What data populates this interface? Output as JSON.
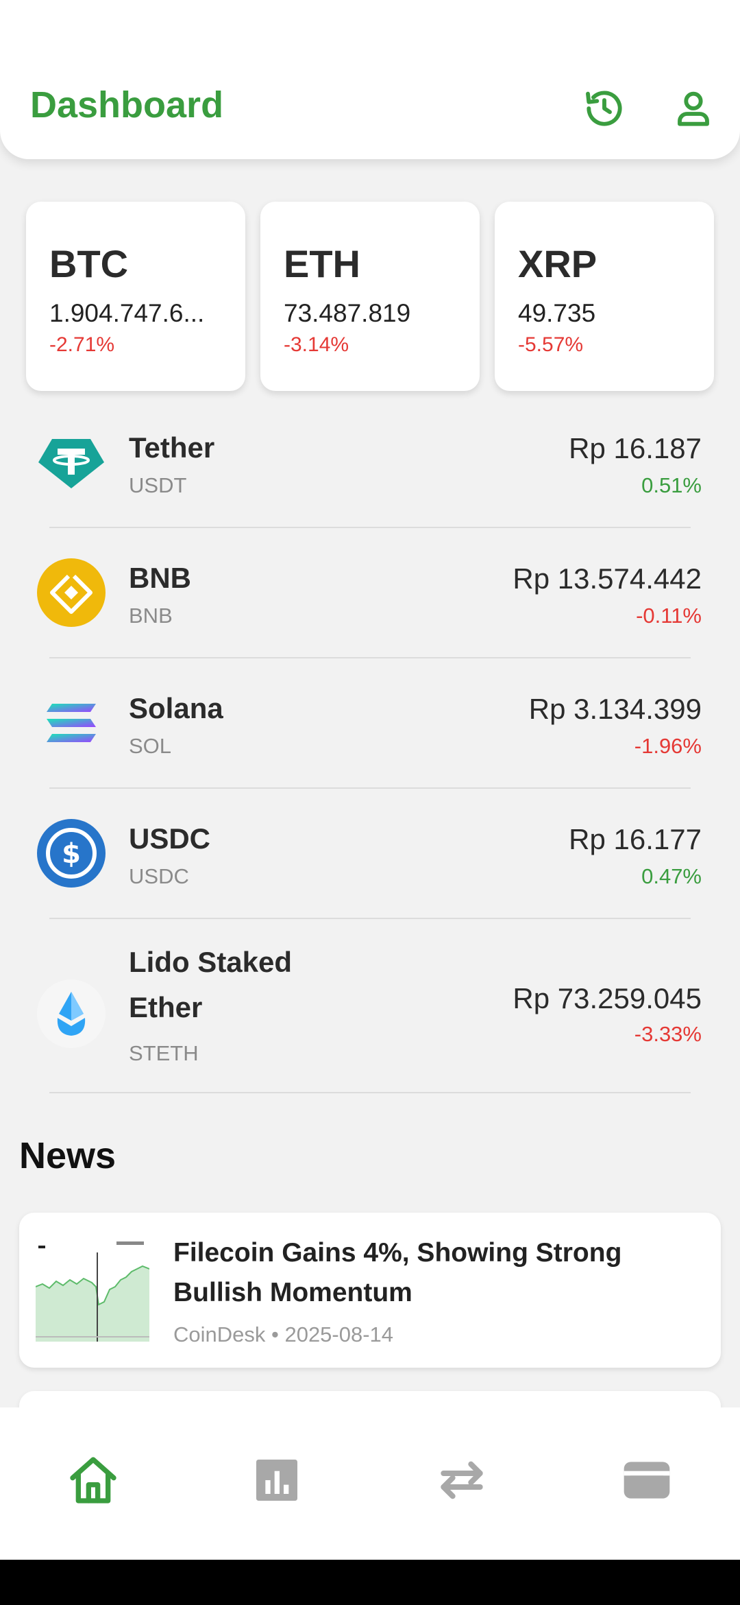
{
  "header": {
    "title": "Dashboard",
    "icons": [
      "history-icon",
      "profile-icon"
    ],
    "accent": "#3a9d3f"
  },
  "tickers": [
    {
      "symbol": "BTC",
      "price": "1.904.747.6...",
      "change": "-2.71%"
    },
    {
      "symbol": "ETH",
      "price": "73.487.819",
      "change": "-3.14%"
    },
    {
      "symbol": "XRP",
      "price": "49.735",
      "change": "-5.57%"
    }
  ],
  "coins": [
    {
      "name": "Tether",
      "ticker": "USDT",
      "price": "Rp 16.187",
      "change": "0.51%",
      "icon": "tether-logo"
    },
    {
      "name": "BNB",
      "ticker": "BNB",
      "price": "Rp 13.574.442",
      "change": "-0.11%",
      "icon": "bnb-logo"
    },
    {
      "name": "Solana",
      "ticker": "SOL",
      "price": "Rp 3.134.399",
      "change": "-1.96%",
      "icon": "solana-logo"
    },
    {
      "name": "USDC",
      "ticker": "USDC",
      "price": "Rp 16.177",
      "change": "0.47%",
      "icon": "usdc-logo"
    },
    {
      "name": "Lido Staked Ether",
      "ticker": "STETH",
      "price": "Rp 73.259.045",
      "change": "-3.33%",
      "icon": "lido-logo"
    }
  ],
  "news": {
    "title": "News",
    "items": [
      {
        "headline": "Filecoin Gains 4%, Showing Strong Bullish Momentum",
        "meta": "CoinDesk • 2025-08-14"
      }
    ]
  },
  "bottom_nav": {
    "items": [
      "home-icon",
      "chart-icon",
      "transfer-icon",
      "wallet-icon"
    ],
    "active": "home-icon"
  },
  "colors": {
    "positive": "#3a9d3f",
    "negative": "#e53935"
  }
}
